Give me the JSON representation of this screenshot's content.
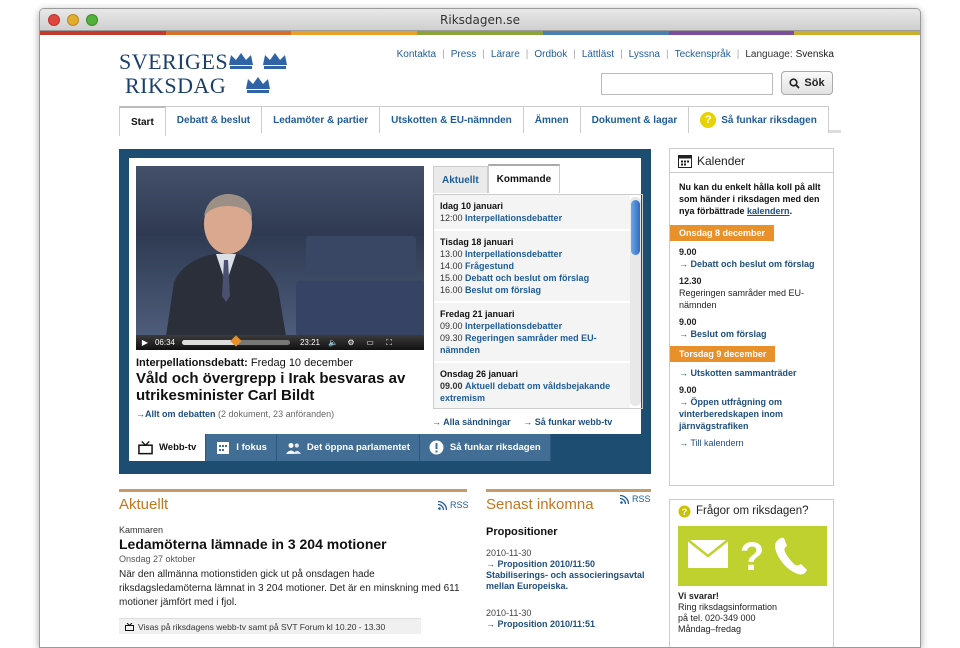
{
  "window": {
    "title": "Riksdagen.se"
  },
  "colors": {
    "brand": "#1b3f6c",
    "link": "#1f5c99",
    "accent_orange": "#e8902a",
    "feature_bg": "#1e4d72",
    "faq_green": "#bfd12f",
    "stripe": [
      "#c23a2b",
      "#d9702a",
      "#e8a02a",
      "#8aa33a",
      "#4a7fb0",
      "#7a4e9a",
      "#c8b02a"
    ]
  },
  "header": {
    "logo_line1": "SVERIGES",
    "logo_line2": "RIKSDAG",
    "links": [
      "Kontakta",
      "Press",
      "Lärare",
      "Ordbok",
      "Lättläst",
      "Lyssna",
      "Teckenspråk"
    ],
    "language_label": "Language:",
    "language_value": "Svenska",
    "search_value": "",
    "search_button": "Sök"
  },
  "nav": [
    "Start",
    "Debatt & beslut",
    "Ledamöter & partier",
    "Utskotten & EU-nämnden",
    "Ämnen",
    "Dokument & lagar",
    "Så funkar riksdagen"
  ],
  "feature": {
    "video": {
      "elapsed": "06:34",
      "duration": "23:21",
      "progress": 0.5
    },
    "kicker_bold": "Interpellationsdebatt:",
    "kicker_date": "Fredag 10 december",
    "title": "Våld och övergrepp i Irak besvaras av utrikesminister Carl Bildt",
    "link": "Allt om debatten",
    "link_meta": "(2 dokument, 23 anföranden)",
    "tabs": [
      "Aktuellt",
      "Kommande"
    ],
    "schedule": [
      {
        "day": "Idag 10 januari",
        "rows": [
          {
            "time": "12:00",
            "label": "Interpellationsdebatter"
          }
        ]
      },
      {
        "day": "Tisdag 18 januari",
        "rows": [
          {
            "time": "13.00",
            "label": "Interpellationsdebatter"
          },
          {
            "time": "14.00",
            "label": "Frågestund"
          },
          {
            "time": "15.00",
            "label": "Debatt och beslut om förslag"
          },
          {
            "time": "16.00",
            "label": "Beslut om förslag"
          }
        ]
      },
      {
        "day": "Fredag 21 januari",
        "rows": [
          {
            "time": "09.00",
            "label": "Interpellationsdebatter"
          },
          {
            "time": "09.30",
            "label": "Regeringen samråder med EU-nämnden"
          }
        ]
      },
      {
        "day": "Onsdag 26 januari",
        "rows": [
          {
            "time": "09.00",
            "label": "Aktuell debatt om våldsbejakande extremism"
          }
        ]
      }
    ],
    "schedule_links": [
      "Alla sändningar",
      "Så funkar webb-tv"
    ],
    "bottom_tabs": [
      "Webb-tv",
      "I fokus",
      "Det öppna parlamentet",
      "Så funkar riksdagen"
    ]
  },
  "calendar": {
    "title": "Kalender",
    "intro": "Nu kan du enkelt hålla koll på allt som händer i riksdagen med den nya förbättrade",
    "intro_link": "kalendern",
    "intro_end": ".",
    "day1": "Onsdag 8 december",
    "items1": [
      {
        "time": "9.00",
        "link": "Debatt och beslut om förslag"
      },
      {
        "time": "12.30",
        "text": "Regeringen samråder med EU-nämnden"
      },
      {
        "time": "9.00",
        "link": "Beslut om förslag"
      }
    ],
    "day2": "Torsdag 9 december",
    "items2": [
      {
        "link": "Utskotten sammanträder"
      },
      {
        "time": "9.00",
        "link": "Öppen utfrågning om vinterberedskapen inom järnvägstrafiken"
      }
    ],
    "more": "Till kalendern"
  },
  "aktuellt": {
    "title": "Aktuellt",
    "rss": "RSS",
    "kicker": "Kammaren",
    "headline": "Ledamöterna lämnade in 3 204 motioner",
    "date": "Onsdag 27 oktober",
    "body": "När den allmänna motionstiden gick ut på onsdagen hade riksdagsledamöterna lämnat in 3 204 motioner. Det är en minskning med 611 motioner jämfört med i fjol.",
    "bar": "Visas på riksdagens webb-tv samt på SVT Forum kl 10.20 - 13.30"
  },
  "inkomna": {
    "title": "Senast inkomna",
    "rss": "RSS",
    "head": "Propositioner",
    "items": [
      {
        "date": "2010-11-30",
        "label": "Proposition 2010/11:50 Stabiliserings- och associeringsavtal mellan Europeiska."
      },
      {
        "date": "2010-11-30",
        "label": "Proposition 2010/11:51"
      }
    ]
  },
  "faq": {
    "title": "Frågor om riksdagen?",
    "answer": "Vi svarar!",
    "line1": "Ring riksdagsinformation",
    "line2": "på tel. 020-349 000",
    "line3": "Måndag–fredag"
  }
}
